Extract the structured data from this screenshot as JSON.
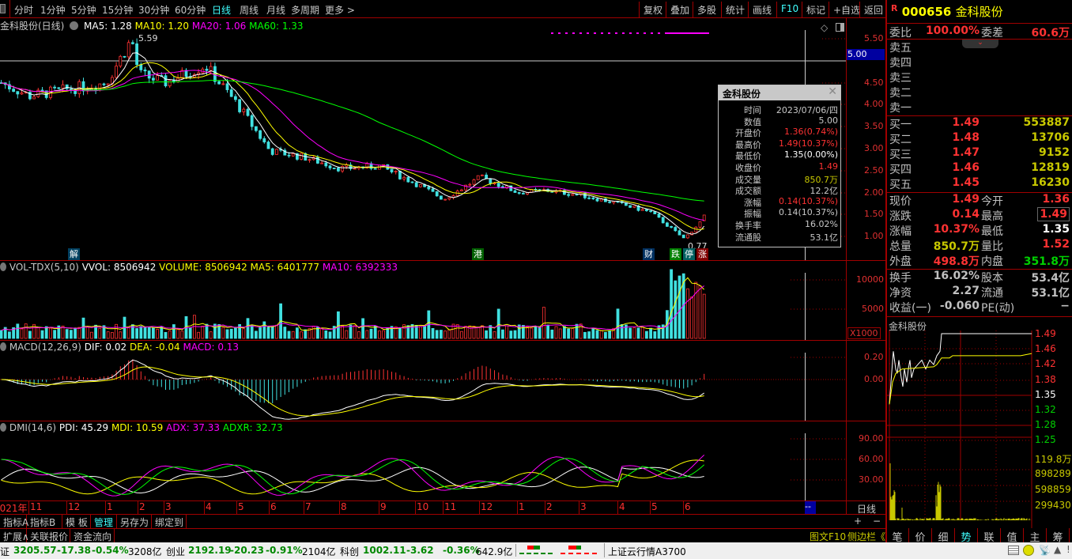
{
  "toolbar": {
    "periods": [
      "分时",
      "1分钟",
      "5分钟",
      "15分钟",
      "30分钟",
      "60分钟",
      "日线",
      "周线",
      "月线",
      "多周期",
      "更多 >"
    ],
    "active_period": "日线",
    "buttons": [
      "复权",
      "叠加",
      "多股",
      "统计",
      "画线",
      "F10",
      "标记",
      "+自选",
      "返回"
    ]
  },
  "main_header": {
    "title": "金科股份(日线)",
    "ma5": "MA5: 1.28",
    "ma10": "MA10: 1.20",
    "ma20": "MA20: 1.06",
    "ma60": "MA60: 1.33"
  },
  "vol_header": {
    "name": "VOL-TDX(5,10)",
    "vvol": "VVOL: 8506942",
    "volume": "VOLUME: 8506942",
    "ma5": "MA5: 6401777",
    "ma10": "MA10: 6392333"
  },
  "macd_header": {
    "name": "MACD(12,26,9)",
    "dif": "DIF: 0.02",
    "dea": "DEA: -0.04",
    "macd": "MACD: 0.13"
  },
  "dmi_header": {
    "name": "DMI(14,6)",
    "pdi": "PDI: 45.29",
    "mdi": "MDI: 10.59",
    "adx": "ADX: 37.33",
    "adxr": "ADXR: 32.73"
  },
  "price_axis": [
    "5.50",
    "5.00",
    "4.50",
    "4.00",
    "3.50",
    "3.00",
    "2.50",
    "2.00",
    "1.50",
    "1.00"
  ],
  "cursor_price": "5.00",
  "vol_axis": [
    "10000",
    "5000"
  ],
  "vol_unit": "X1000",
  "macd_axis": [
    "0.20",
    "0.00"
  ],
  "dmi_axis": [
    "90.00",
    "60.00",
    "30.00"
  ],
  "annotations": {
    "high": "5.59",
    "low": "0.77"
  },
  "event_markers": [
    {
      "label": "解",
      "bg": "#004060"
    },
    {
      "label": "港",
      "bg": "#006000"
    },
    {
      "label": "财",
      "bg": "#003060"
    },
    {
      "label": "跌",
      "bg": "#008000"
    },
    {
      "label": "停",
      "bg": "#006060"
    },
    {
      "label": "涨",
      "bg": "#800000"
    }
  ],
  "date_axis": {
    "year_label": "2021年",
    "months": [
      "11",
      "12",
      "1",
      "2",
      "3",
      "4",
      "5",
      "6",
      "7",
      "8",
      "9",
      "10",
      "11",
      "12",
      "1",
      "2",
      "3",
      "4",
      "5",
      "6"
    ],
    "cursor_label": "--",
    "period_label": "日线"
  },
  "bottom_tabs": [
    "指标A",
    "指标B",
    "模 板",
    "管理",
    "另存为",
    "绑定到"
  ],
  "active_bottom_tab": "管理",
  "bottom_tabs2": [
    "扩展∧",
    "关联报价",
    "资金流向"
  ],
  "zoom_buttons": [
    "+",
    "−"
  ],
  "side_links": [
    "图文F10",
    "侧边栏《"
  ],
  "tooltip": {
    "title": "金科股份",
    "rows": [
      {
        "k": "时间",
        "v": "2023/07/06/四",
        "c": "#c8c8c8"
      },
      {
        "k": "数值",
        "v": "5.00",
        "c": "#c8c8c8"
      },
      {
        "k": "开盘价",
        "v": "1.36(0.74%)",
        "c": "#ff3232"
      },
      {
        "k": "最高价",
        "v": "1.49(10.37%)",
        "c": "#ff3232"
      },
      {
        "k": "最低价",
        "v": "1.35(0.00%)",
        "c": "#ffffff"
      },
      {
        "k": "收盘价",
        "v": "1.49",
        "c": "#ff3232"
      },
      {
        "k": "成交量",
        "v": "850.7万",
        "c": "#c8c800"
      },
      {
        "k": "成交额",
        "v": "12.2亿",
        "c": "#c8c8c8"
      },
      {
        "k": "涨幅",
        "v": "0.14(10.37%)",
        "c": "#ff3232"
      },
      {
        "k": "振幅",
        "v": "0.14(10.37%)",
        "c": "#c8c8c8"
      },
      {
        "k": "换手率",
        "v": "16.02%",
        "c": "#c8c8c8"
      },
      {
        "k": "流通股",
        "v": "53.1亿",
        "c": "#c8c8c8"
      }
    ]
  },
  "quote": {
    "badge": "R",
    "code": "000656",
    "name": "金科股份",
    "weibi_label": "委比",
    "weibi": "100.00%",
    "weicha_label": "委差",
    "weicha": "60.6万",
    "sell": [
      {
        "label": "卖五"
      },
      {
        "label": "卖四"
      },
      {
        "label": "卖三"
      },
      {
        "label": "卖二"
      },
      {
        "label": "卖一"
      }
    ],
    "buy": [
      {
        "label": "买一",
        "price": "1.49",
        "vol": "553887"
      },
      {
        "label": "买二",
        "price": "1.48",
        "vol": "13706"
      },
      {
        "label": "买三",
        "price": "1.47",
        "vol": "9152"
      },
      {
        "label": "买四",
        "price": "1.46",
        "vol": "12819"
      },
      {
        "label": "买五",
        "price": "1.45",
        "vol": "16230"
      }
    ],
    "stats": [
      {
        "k1": "现价",
        "v1": "1.49",
        "c1": "#ff3232",
        "k2": "今开",
        "v2": "1.36",
        "c2": "#ff3232"
      },
      {
        "k1": "涨跌",
        "v1": "0.14",
        "c1": "#ff3232",
        "k2": "最高",
        "v2": "1.49",
        "c2": "#ff3232"
      },
      {
        "k1": "涨幅",
        "v1": "10.37%",
        "c1": "#ff3232",
        "k2": "最低",
        "v2": "1.35",
        "c2": "#ffffff"
      },
      {
        "k1": "总量",
        "v1": "850.7万",
        "c1": "#c8c800",
        "k2": "量比",
        "v2": "1.52",
        "c2": "#ff3232"
      },
      {
        "k1": "外盘",
        "v1": "498.8万",
        "c1": "#ff3232",
        "k2": "内盘",
        "v2": "351.8万",
        "c2": "#00d000"
      }
    ],
    "fundamentals": [
      {
        "k1": "换手",
        "v1": "16.02%",
        "k2": "股本",
        "v2": "53.4亿"
      },
      {
        "k1": "净资",
        "v1": "2.27",
        "k2": "流通",
        "v2": "53.1亿"
      },
      {
        "k1": "收益(一)",
        "v1": "-0.060",
        "k2": "PE(动)",
        "v2": "−"
      }
    ]
  },
  "intraday": {
    "title": "金科股份",
    "price_axis": [
      {
        "v": "1.49",
        "c": "#ff3232"
      },
      {
        "v": "1.46",
        "c": "#ff3232"
      },
      {
        "v": "1.42",
        "c": "#ff3232"
      },
      {
        "v": "1.38",
        "c": "#ff3232"
      },
      {
        "v": "1.35",
        "c": "#ffffff"
      },
      {
        "v": "1.32",
        "c": "#00d000"
      },
      {
        "v": "1.28",
        "c": "#00d000"
      },
      {
        "v": "1.25",
        "c": "#00d000"
      }
    ],
    "vol_axis": [
      "119.8万",
      "898289",
      "598859",
      "299430"
    ],
    "tabs": [
      "笔",
      "价",
      "细",
      "势",
      "联",
      "值",
      "主",
      "筹"
    ],
    "active_tab": "势"
  },
  "status_bar": {
    "sh_label": "证",
    "sh_value": "3205.57",
    "sh_change": "-17.38",
    "sh_pct": "-0.54%",
    "sh_amount": "3208亿",
    "cy_label": "创业",
    "cy_value": "2192.19",
    "cy_change": "-20.23",
    "cy_pct": "-0.91%",
    "cy_amount": "2104亿",
    "kc_label": "科创",
    "kc_value": "1002.11",
    "kc_change": "-3.62",
    "kc_pct": "-0.36%",
    "kc_amount": "642.9亿",
    "server": "上证云行情A3700"
  },
  "colors": {
    "up": "#ff3232",
    "down": "#40e0e0",
    "ma5": "#ffffff",
    "ma10": "#ffff00",
    "ma20": "#ff00ff",
    "ma60": "#00ff00",
    "grid": "#a00000",
    "accent": "#40ffff"
  },
  "chart_data": {
    "type": "candlestick",
    "symbol": "金科股份",
    "period": "日线",
    "price_ylim": [
      0.77,
      5.59
    ],
    "monthly_close_approx": [
      {
        "m": "2021-10",
        "c": 4.5
      },
      {
        "m": "2021-11",
        "c": 4.2
      },
      {
        "m": "2021-12",
        "c": 4.35
      },
      {
        "m": "2022-01",
        "c": 4.5
      },
      {
        "m": "2022-01 peak",
        "c": 5.5
      },
      {
        "m": "2022-02",
        "c": 4.7
      },
      {
        "m": "2022-03",
        "c": 4.5
      },
      {
        "m": "2022-04",
        "c": 4.9
      },
      {
        "m": "2022-05",
        "c": 4.0
      },
      {
        "m": "2022-06",
        "c": 2.95
      },
      {
        "m": "2022-07",
        "c": 2.8
      },
      {
        "m": "2022-08",
        "c": 2.55
      },
      {
        "m": "2022-09",
        "c": 2.6
      },
      {
        "m": "2022-10",
        "c": 2.2
      },
      {
        "m": "2022-11",
        "c": 1.85
      },
      {
        "m": "2022-12",
        "c": 2.35
      },
      {
        "m": "2023-01",
        "c": 2.0
      },
      {
        "m": "2023-02",
        "c": 2.05
      },
      {
        "m": "2023-03",
        "c": 1.95
      },
      {
        "m": "2023-04",
        "c": 1.75
      },
      {
        "m": "2023-05",
        "c": 1.55
      },
      {
        "m": "2023-06",
        "c": 0.95
      },
      {
        "m": "2023-07-06",
        "c": 1.49
      }
    ],
    "ma": {
      "ma5": 1.28,
      "ma10": 1.2,
      "ma20": 1.06,
      "ma60": 1.33
    },
    "last_volume": 8506942,
    "macd": {
      "dif": 0.02,
      "dea": -0.04,
      "macd": 0.13
    },
    "dmi": {
      "pdi": 45.29,
      "mdi": 10.59,
      "adx": 37.33,
      "adxr": 32.73
    }
  }
}
